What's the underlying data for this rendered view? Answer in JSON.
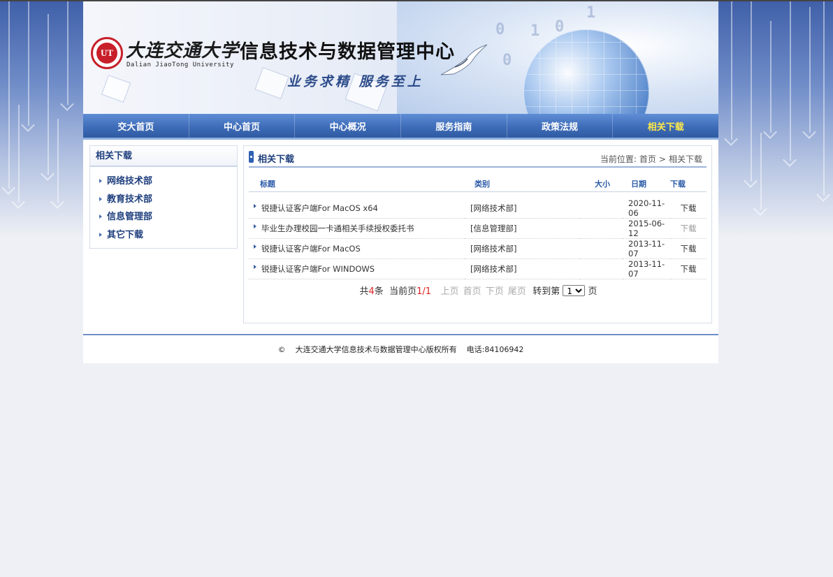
{
  "header": {
    "university_cn": "大连交通大学",
    "university_en": "Dalian JiaoTong University",
    "site_title": "信息技术与数据管理中心",
    "slogan": "业务求精  服务至上"
  },
  "nav": [
    {
      "label": "交大首页"
    },
    {
      "label": "中心首页"
    },
    {
      "label": "中心概况"
    },
    {
      "label": "服务指南"
    },
    {
      "label": "政策法规"
    },
    {
      "label": "相关下载",
      "active": true
    }
  ],
  "sidebar": {
    "title": "相关下载",
    "items": [
      {
        "label": "网络技术部"
      },
      {
        "label": "教育技术部"
      },
      {
        "label": "信息管理部"
      },
      {
        "label": "其它下载"
      }
    ]
  },
  "main": {
    "title": "相关下载",
    "breadcrumb": {
      "prefix": "当前位置:",
      "home": "首页",
      "sep": ">",
      "current": "相关下载"
    },
    "columns": {
      "title": "标题",
      "category": "类别",
      "size": "大小",
      "date": "日期",
      "download": "下载"
    },
    "rows": [
      {
        "title": "锐捷认证客户端For MacOS x64",
        "category": "[网络技术部]",
        "size": "",
        "date": "2020-11-06",
        "download": "下载"
      },
      {
        "title": "毕业生办理校园一卡通相关手续授权委托书",
        "category": "[信息管理部]",
        "size": "",
        "date": "2015-06-12",
        "download": "下载",
        "muted": true
      },
      {
        "title": "锐捷认证客户端For MacOS",
        "category": "[网络技术部]",
        "size": "",
        "date": "2013-11-07",
        "download": "下载"
      },
      {
        "title": "锐捷认证客户端For WINDOWS",
        "category": "[网络技术部]",
        "size": "",
        "date": "2013-11-07",
        "download": "下载"
      }
    ],
    "pager": {
      "total_prefix": "共",
      "total": "4",
      "total_suffix": "条",
      "current_prefix": "当前页",
      "current": "1",
      "slash": "/",
      "pages": "1",
      "prev": "上页",
      "first": "首页",
      "next": "下页",
      "last": "尾页",
      "goto_prefix": "转到第",
      "goto_value": "1",
      "goto_suffix": "页"
    }
  },
  "footer": {
    "copyright": "©",
    "owner": "大连交通大学信息技术与数据管理中心版权所有",
    "phone": "电话:84106942"
  }
}
